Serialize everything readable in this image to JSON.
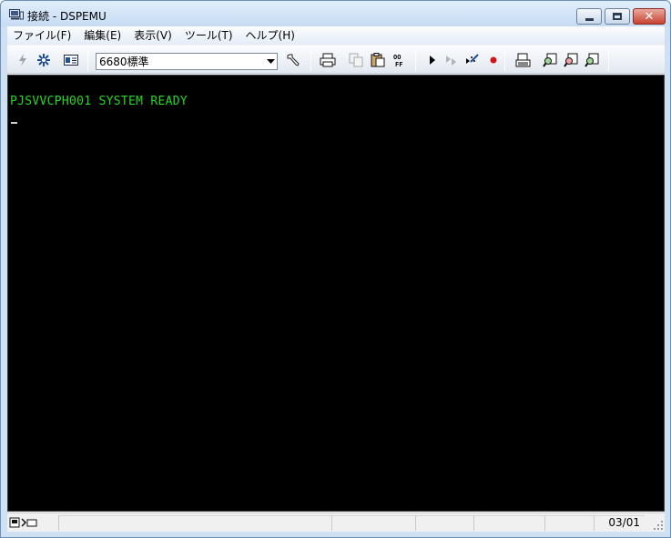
{
  "window": {
    "title": "接続 - DSPEMU"
  },
  "menu": {
    "items": [
      {
        "label": "ファイル(F)"
      },
      {
        "label": "編集(E)"
      },
      {
        "label": "表示(V)"
      },
      {
        "label": "ツール(T)"
      },
      {
        "label": "ヘルプ(H)"
      }
    ]
  },
  "toolbar": {
    "profile_select": {
      "value": "6680標準"
    },
    "buttons": [
      "connect-icon",
      "asterisk-icon",
      "card-icon",
      "wrench-icon",
      "printer-icon",
      "copy-icon",
      "paste-icon",
      "off-icon",
      "play-icon",
      "step-icon",
      "macro-icon",
      "record-icon",
      "terminal-icon",
      "search-1-icon",
      "search-2-icon",
      "search-3-icon"
    ]
  },
  "terminal": {
    "line1": "PJSVVCPH001 SYSTEM READY",
    "text_color": "#22d822",
    "background": "#000000"
  },
  "status": {
    "cursor_position": "03/01"
  }
}
